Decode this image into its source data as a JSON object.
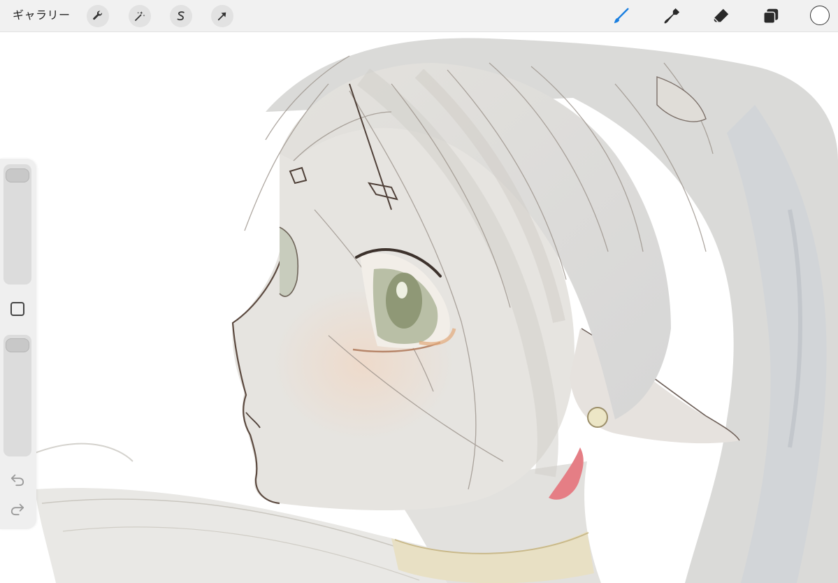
{
  "toolbar": {
    "gallery_label": "ギャラリー",
    "left_tools": [
      {
        "name": "actions",
        "icon": "wrench-icon"
      },
      {
        "name": "adjustments",
        "icon": "magic-wand-icon"
      },
      {
        "name": "selection",
        "icon": "selection-s-icon"
      },
      {
        "name": "transform",
        "icon": "arrow-cursor-icon"
      }
    ],
    "right_tools": [
      {
        "name": "brush",
        "icon": "brush-icon",
        "active": true
      },
      {
        "name": "smudge",
        "icon": "smudge-finger-icon",
        "active": false
      },
      {
        "name": "eraser",
        "icon": "eraser-icon",
        "active": false
      },
      {
        "name": "layers",
        "icon": "layers-icon",
        "active": false
      }
    ],
    "active_color": "#ffffff",
    "accent_color": "#1a7fe0"
  },
  "sidebar": {
    "brush_size_level": 0.97,
    "opacity_level": 0.98,
    "modify_icon": "square-icon",
    "undo_icon": "undo-arrow-icon",
    "redo_icon": "redo-arrow-icon"
  },
  "canvas": {
    "content": "sketch-illustration"
  }
}
